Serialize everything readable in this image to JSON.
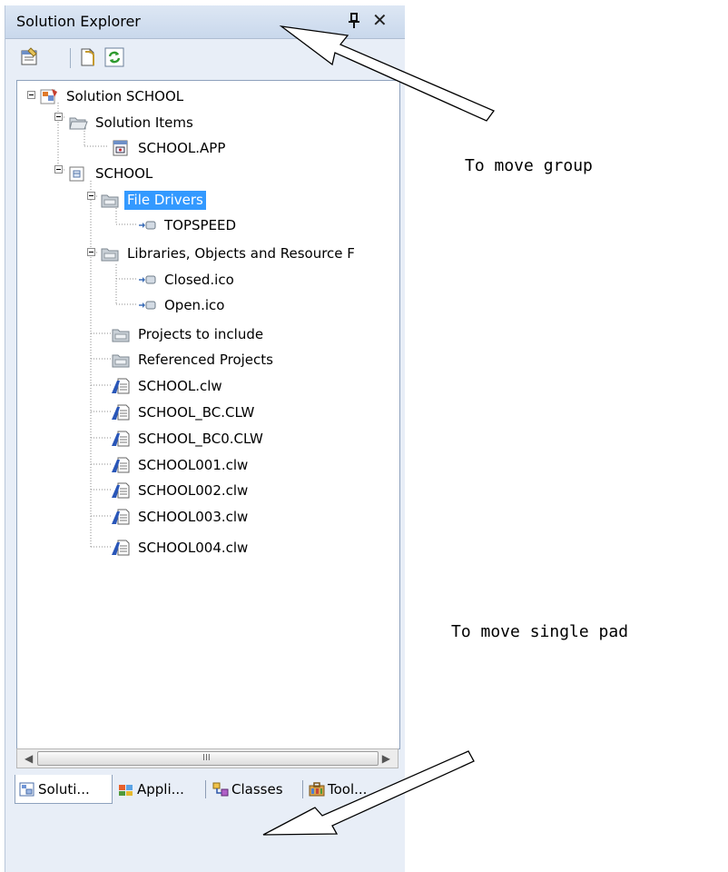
{
  "pad": {
    "title": "Solution Explorer",
    "pin_icon": "pin-icon",
    "close_glyph": "✕"
  },
  "toolbar": {
    "buttons": [
      {
        "icon": "properties-icon"
      },
      {
        "icon": "show-all-files-icon"
      },
      {
        "icon": "refresh-icon"
      }
    ]
  },
  "tree": {
    "nodes": [
      {
        "label": "Solution SCHOOL",
        "icon": "solution-icon",
        "expanded": true
      },
      {
        "label": "Solution Items",
        "icon": "open-folder-icon",
        "expanded": true
      },
      {
        "label": "SCHOOL.APP",
        "icon": "app-file-icon"
      },
      {
        "label": "SCHOOL",
        "icon": "project-icon",
        "expanded": true
      },
      {
        "label": "File Drivers",
        "icon": "folder-icon",
        "expanded": true,
        "selected": true
      },
      {
        "label": "TOPSPEED",
        "icon": "reference-icon"
      },
      {
        "label": "Libraries, Objects and Resource F",
        "icon": "folder-icon",
        "expanded": true
      },
      {
        "label": "Closed.ico",
        "icon": "reference-icon"
      },
      {
        "label": "Open.ico",
        "icon": "reference-icon"
      },
      {
        "label": "Projects to include",
        "icon": "folder-icon"
      },
      {
        "label": "Referenced Projects",
        "icon": "folder-icon"
      },
      {
        "label": "SCHOOL.clw",
        "icon": "clw-file-icon"
      },
      {
        "label": "SCHOOL_BC.CLW",
        "icon": "clw-file-icon"
      },
      {
        "label": "SCHOOL_BC0.CLW",
        "icon": "clw-file-icon"
      },
      {
        "label": "SCHOOL001.clw",
        "icon": "clw-file-icon"
      },
      {
        "label": "SCHOOL002.clw",
        "icon": "clw-file-icon"
      },
      {
        "label": "SCHOOL003.clw",
        "icon": "clw-file-icon"
      },
      {
        "label": "SCHOOL004.clw",
        "icon": "clw-file-icon"
      }
    ]
  },
  "scrollbar": {
    "grip": "III"
  },
  "tabs": [
    {
      "label": "Soluti...",
      "icon": "solution-explorer-icon",
      "active": true
    },
    {
      "label": "Appli...",
      "icon": "application-icon"
    },
    {
      "label": "Classes",
      "icon": "classes-icon"
    },
    {
      "label": "Tool...",
      "icon": "toolbox-icon"
    }
  ],
  "annotations": {
    "group": "To move group",
    "single": "To move single pad"
  },
  "colors": {
    "selection": "#3399ff",
    "frame": "#e8eef7",
    "titlebar": "#c9d8ec",
    "folder": "#a9b3bd"
  }
}
